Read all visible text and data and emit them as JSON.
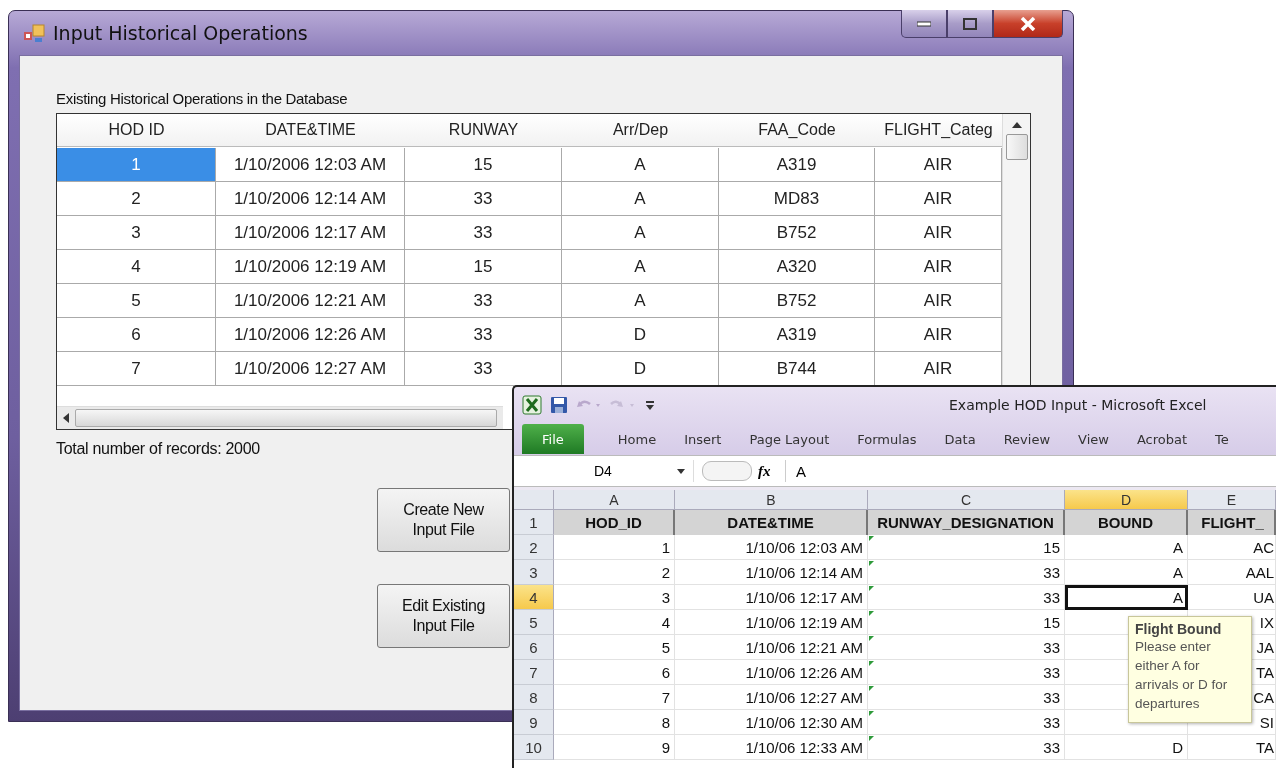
{
  "hod_window": {
    "title": "Input Historical Operations",
    "caption": "Existing Historical Operations in the Database",
    "columns": [
      "HOD ID",
      "DATE&TIME",
      "RUNWAY",
      "Arr/Dep",
      "FAA_Code",
      "FLIGHT_Categ"
    ],
    "rows": [
      {
        "selected": true,
        "cells": [
          "1",
          "1/10/2006 12:03 AM",
          "15",
          "A",
          "A319",
          "AIR"
        ]
      },
      {
        "selected": false,
        "cells": [
          "2",
          "1/10/2006 12:14 AM",
          "33",
          "A",
          "MD83",
          "AIR"
        ]
      },
      {
        "selected": false,
        "cells": [
          "3",
          "1/10/2006 12:17 AM",
          "33",
          "A",
          "B752",
          "AIR"
        ]
      },
      {
        "selected": false,
        "cells": [
          "4",
          "1/10/2006 12:19 AM",
          "15",
          "A",
          "A320",
          "AIR"
        ]
      },
      {
        "selected": false,
        "cells": [
          "5",
          "1/10/2006 12:21 AM",
          "33",
          "A",
          "B752",
          "AIR"
        ]
      },
      {
        "selected": false,
        "cells": [
          "6",
          "1/10/2006 12:26 AM",
          "33",
          "D",
          "A319",
          "AIR"
        ]
      },
      {
        "selected": false,
        "cells": [
          "7",
          "1/10/2006 12:27 AM",
          "33",
          "D",
          "B744",
          "AIR"
        ]
      }
    ],
    "total": "Total number of records: 2000",
    "buttons": [
      "Create New Input File",
      "Edit Existing Input File"
    ]
  },
  "excel_window": {
    "title": "Example HOD Input  -  Microsoft Excel",
    "ribbon_tabs": [
      {
        "label": "File",
        "kind": "file"
      },
      {
        "label": "Home",
        "kind": "tab"
      },
      {
        "label": "Insert",
        "kind": "tab"
      },
      {
        "label": "Page Layout",
        "kind": "tab"
      },
      {
        "label": "Formulas",
        "kind": "tab"
      },
      {
        "label": "Data",
        "kind": "tab"
      },
      {
        "label": "Review",
        "kind": "tab"
      },
      {
        "label": "View",
        "kind": "tab"
      },
      {
        "label": "Acrobat",
        "kind": "tab"
      },
      {
        "label": "Te",
        "kind": "tab"
      }
    ],
    "name_box": "D4",
    "function_label": "fx",
    "formula": "A",
    "columns": [
      {
        "label": "A",
        "selected": false
      },
      {
        "label": "B",
        "selected": false
      },
      {
        "label": "C",
        "selected": false
      },
      {
        "label": "D",
        "selected": true
      },
      {
        "label": "E",
        "selected": false
      }
    ],
    "rows": [
      {
        "number": "1",
        "kind": "header",
        "selected": false,
        "cells": {
          "a": "HOD_ID",
          "b": "DATE&TIME",
          "c": "RUNWAY_DESIGNATION",
          "d": "BOUND",
          "e": "FLIGHT_"
        }
      },
      {
        "number": "2",
        "kind": "data",
        "selected": false,
        "cells": {
          "a": "1",
          "b": "1/10/06 12:03 AM",
          "c": "15",
          "d": "A",
          "e": "AC"
        }
      },
      {
        "number": "3",
        "kind": "data",
        "selected": false,
        "cells": {
          "a": "2",
          "b": "1/10/06 12:14 AM",
          "c": "33",
          "d": "A",
          "e": "AAL"
        }
      },
      {
        "number": "4",
        "kind": "data",
        "selected": true,
        "cells": {
          "a": "3",
          "b": "1/10/06 12:17 AM",
          "c": "33",
          "d": "A",
          "e": "UA"
        }
      },
      {
        "number": "5",
        "kind": "data",
        "selected": false,
        "cells": {
          "a": "4",
          "b": "1/10/06 12:19 AM",
          "c": "15",
          "e": "IX"
        }
      },
      {
        "number": "6",
        "kind": "data",
        "selected": false,
        "cells": {
          "a": "5",
          "b": "1/10/06 12:21 AM",
          "c": "33",
          "e": "JA"
        }
      },
      {
        "number": "7",
        "kind": "data",
        "selected": false,
        "cells": {
          "a": "6",
          "b": "1/10/06 12:26 AM",
          "c": "33",
          "e": "TA"
        }
      },
      {
        "number": "8",
        "kind": "data",
        "selected": false,
        "cells": {
          "a": "7",
          "b": "1/10/06 12:27 AM",
          "c": "33",
          "e": "CA"
        }
      },
      {
        "number": "9",
        "kind": "data",
        "selected": false,
        "cells": {
          "a": "8",
          "b": "1/10/06 12:30 AM",
          "c": "33",
          "e": "SI"
        }
      },
      {
        "number": "10",
        "kind": "data",
        "selected": false,
        "cells": {
          "a": "9",
          "b": "1/10/06 12:33 AM",
          "c": "33",
          "d": "D",
          "e": "TA"
        }
      }
    ],
    "tooltip": {
      "title": "Flight Bound",
      "text": "Please enter either A for arrivals or D for departures"
    }
  }
}
